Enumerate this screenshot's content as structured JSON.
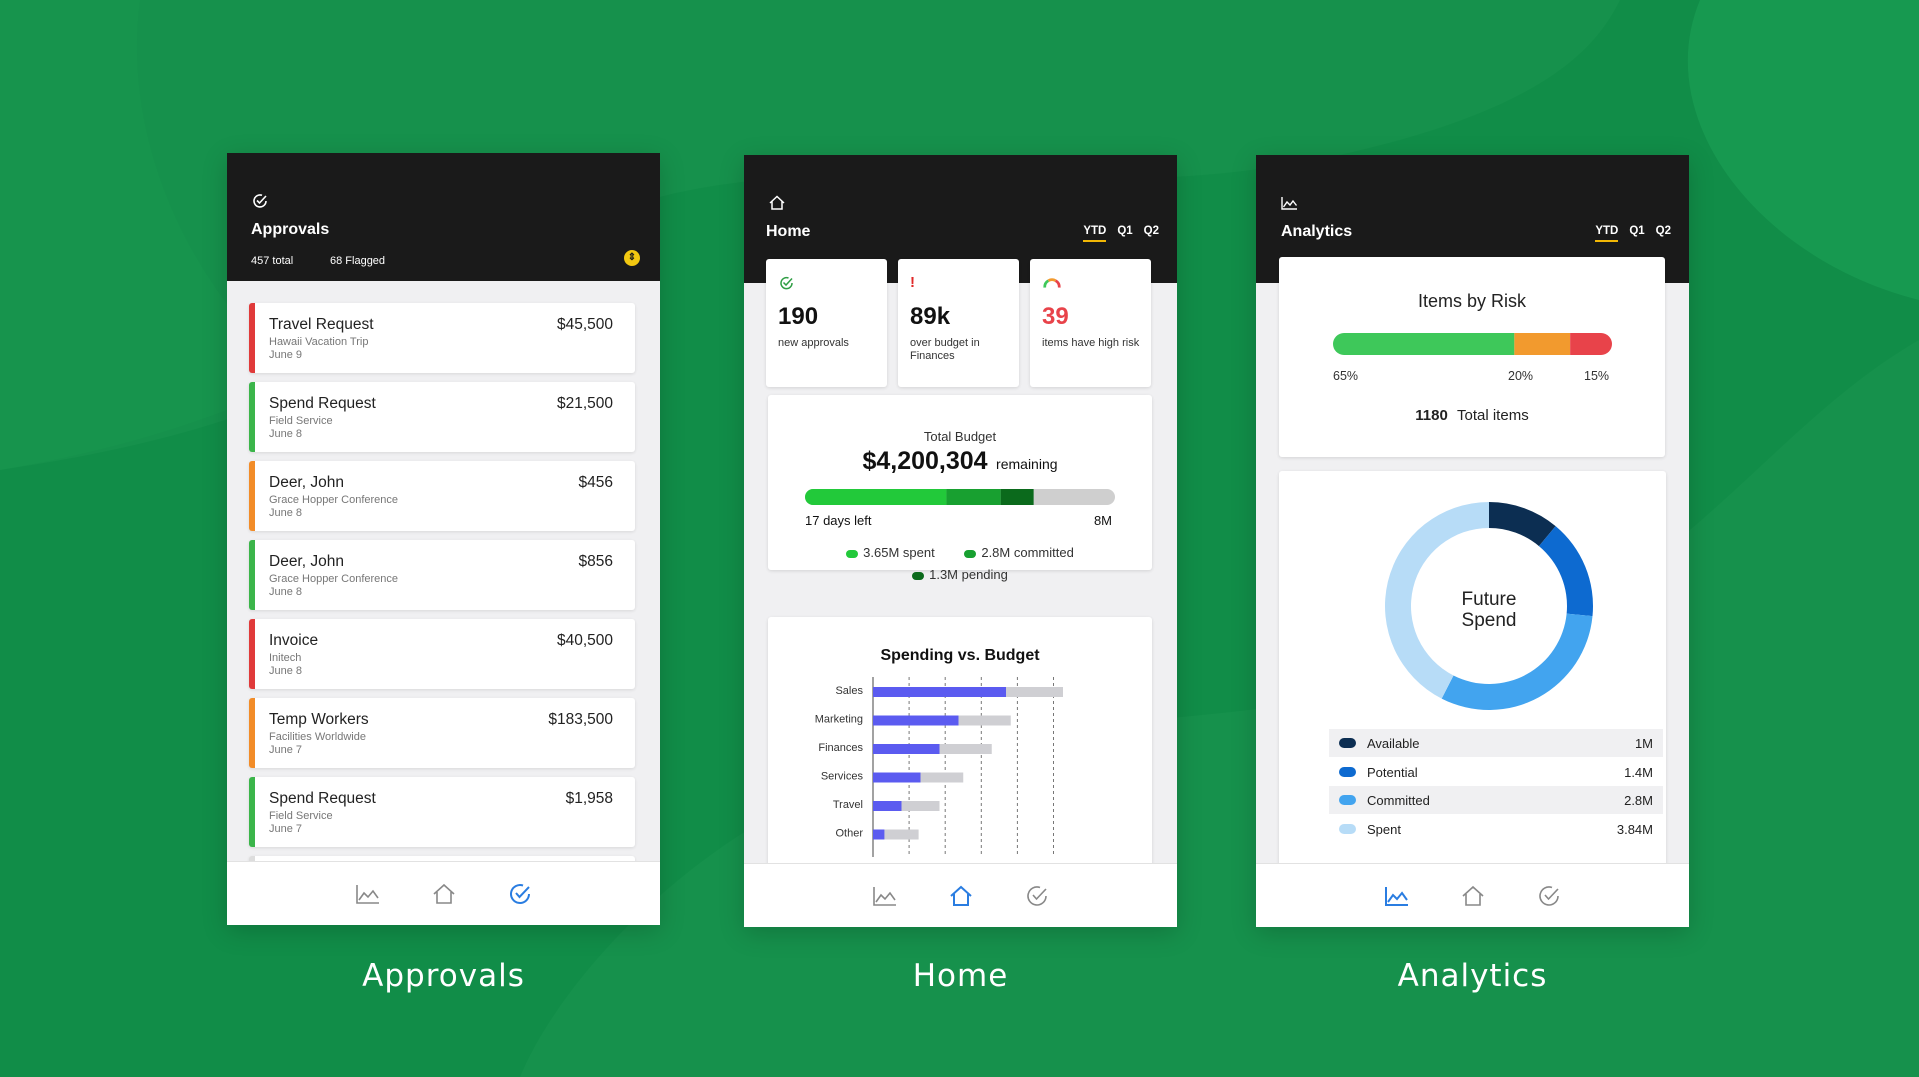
{
  "background": {
    "color": "#16914c",
    "shade": "#0f8040",
    "light": "#1aa055"
  },
  "approvals": {
    "title": "Approvals",
    "total": "457 total",
    "flagged": "68 Flagged",
    "items": [
      {
        "title": "Travel Request",
        "sub": "Hawaii Vacation Trip",
        "date": "June 9",
        "amount": "$45,500",
        "color": "#e03a3a"
      },
      {
        "title": "Spend Request",
        "sub": "Field Service",
        "date": "June 8",
        "amount": "$21,500",
        "color": "#3bb54a"
      },
      {
        "title": "Deer, John",
        "sub": "Grace Hopper Conference",
        "date": "June 8",
        "amount": "$456",
        "color": "#f28c28"
      },
      {
        "title": "Deer, John",
        "sub": "Grace Hopper Conference",
        "date": "June 8",
        "amount": "$856",
        "color": "#3bb54a"
      },
      {
        "title": "Invoice",
        "sub": "Initech",
        "date": "June 8",
        "amount": "$40,500",
        "color": "#e03a3a"
      },
      {
        "title": "Temp Workers",
        "sub": "Facilities Worldwide",
        "date": "June 7",
        "amount": "$183,500",
        "color": "#f28c28"
      },
      {
        "title": "Spend Request",
        "sub": "Field Service",
        "date": "June 7",
        "amount": "$1,958",
        "color": "#3bb54a"
      }
    ],
    "caption": "Approvals"
  },
  "home": {
    "title": "Home",
    "tabs": [
      "YTD",
      "Q1",
      "Q2"
    ],
    "stats": [
      {
        "value": "190",
        "label": "new approvals",
        "icon": "approval-check-icon"
      },
      {
        "value": "89k",
        "label": "over budget in Finances",
        "icon": "exclamation-icon"
      },
      {
        "value": "39",
        "label": "items have high risk",
        "icon": "risk-gauge-icon"
      }
    ],
    "budget": {
      "title": "Total Budget",
      "amount": "$4,200,304",
      "remaining": "remaining",
      "days_left": "17 days left",
      "max": "8M",
      "spent": "3.65M spent",
      "committed": "2.8M committed",
      "pending": "1.3M pending",
      "spent_value": 3.65,
      "committed_value": 1.4,
      "pending_value": 0.85,
      "total_value": 8,
      "colors": {
        "spent": "#22c93a",
        "committed": "#18a030",
        "pending": "#0b6a1c",
        "rest": "#cfcfcf"
      }
    },
    "caption": "Home"
  },
  "chart_data": {
    "type": "bar",
    "title": "Spending vs. Budget",
    "categories": [
      "Sales",
      "Marketing",
      "Finances",
      "Services",
      "Travel",
      "Other"
    ],
    "series": [
      {
        "values": [
          14,
          9,
          7,
          5,
          3,
          1.2
        ],
        "color": "#5b5bf0"
      },
      {
        "values": [
          20,
          14.5,
          12.5,
          9.5,
          7,
          4.8
        ],
        "color": "#cfcfd3"
      }
    ],
    "xlim": [
      0,
      20
    ],
    "grid": "dashed-vertical",
    "xlabel": "",
    "ylabel": ""
  },
  "analytics": {
    "title": "Analytics",
    "tabs": [
      "YTD",
      "Q1",
      "Q2"
    ],
    "risk": {
      "title": "Items by Risk",
      "segments": [
        {
          "pct": "65%",
          "value": 65,
          "color": "#3ec85a"
        },
        {
          "pct": "20%",
          "value": 20,
          "color": "#f29a2e"
        },
        {
          "pct": "15%",
          "value": 15,
          "color": "#e8434a"
        }
      ],
      "total_number": "1180",
      "total_label": "Total items"
    },
    "donut": {
      "center_line1": "Future",
      "center_line2": "Spend",
      "legend": [
        {
          "name": "Available",
          "value": "1M",
          "amount": 1,
          "color": "#0c2e52"
        },
        {
          "name": "Potential",
          "value": "1.4M",
          "amount": 1.4,
          "color": "#0d6ad0"
        },
        {
          "name": "Committed",
          "value": "2.8M",
          "amount": 2.8,
          "color": "#42a4ef"
        },
        {
          "name": "Spent",
          "value": "3.84M",
          "amount": 3.84,
          "color": "#b7dcf7"
        }
      ]
    },
    "caption": "Analytics"
  }
}
